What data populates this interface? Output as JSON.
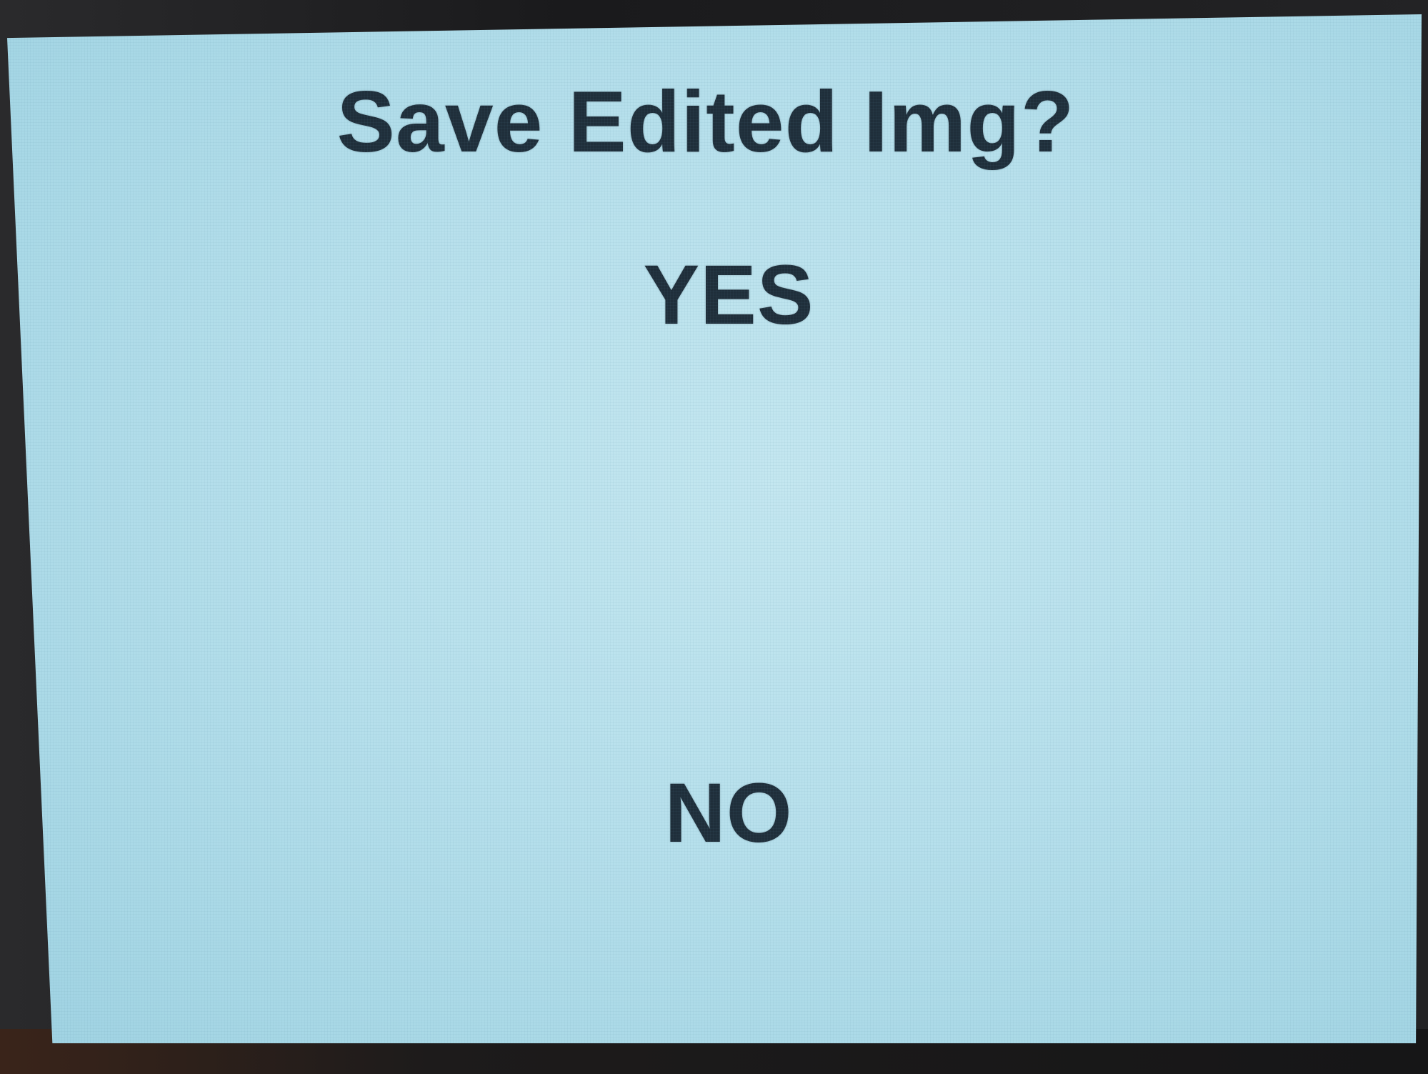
{
  "dialog": {
    "title": "Save Edited Img?",
    "options": [
      {
        "label": "YES"
      },
      {
        "label": "NO"
      }
    ]
  },
  "colors": {
    "screen_background": "#b7e0ec",
    "text": "#1f2e3a",
    "bezel": "#1b1b1d"
  }
}
